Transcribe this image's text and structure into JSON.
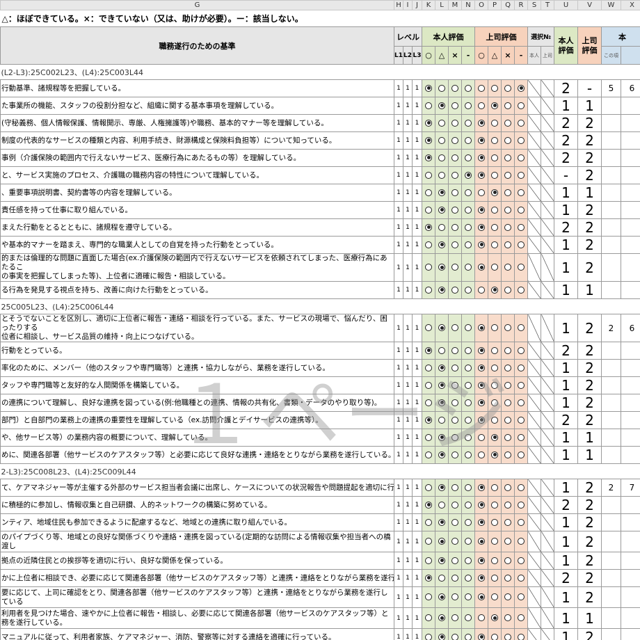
{
  "columns": [
    "G",
    "H",
    "I",
    "J",
    "K",
    "L",
    "M",
    "N",
    "O",
    "P",
    "Q",
    "R",
    "S",
    "T",
    "U",
    "V",
    "W",
    "X"
  ],
  "legend": "△：ほぼできている。×：できていない（又は、助けが必要）。ー：該当しない。",
  "header": {
    "criteria": "職務遂行のための基準",
    "level": "レベル",
    "level_sub": [
      "L1",
      "L2",
      "L3"
    ],
    "self_eval": "本人評価",
    "boss_eval": "上司評価",
    "eval_marks": [
      "○",
      "△",
      "×",
      "-"
    ],
    "select_no": "選択№",
    "select_sub": [
      "本人",
      "上司"
    ],
    "self_score": "本人評価",
    "boss_score": "上司評価",
    "extra": "本",
    "extra_sub": "この項"
  },
  "watermark": "１ページ",
  "rows": [
    {
      "type": "section",
      "text": "(L2-L3):25C002L23、(L4):25C003L44"
    },
    {
      "type": "item",
      "text": "行動基準、諸規程等を把握している。",
      "lv": [
        "1",
        "1",
        "1"
      ],
      "self": 0,
      "boss": 3,
      "ss": "2",
      "bs": "-",
      "w": "5",
      "x": "6"
    },
    {
      "type": "item",
      "text": "た事業所の機能、スタッフの役割分担など、組織に関する基本事項を理解している。",
      "lv": [
        "1",
        "1",
        "1"
      ],
      "self": 1,
      "boss": 1,
      "ss": "1",
      "bs": "1",
      "w": "",
      "x": ""
    },
    {
      "type": "item",
      "text": "(守秘義務、個人情報保護、情報開示、専厳、人権擁護等)や職務、基本的マナー等を理解している。",
      "lv": [
        "1",
        "1",
        "1"
      ],
      "self": 0,
      "boss": 0,
      "ss": "2",
      "bs": "2",
      "w": "",
      "x": ""
    },
    {
      "type": "item",
      "text": "制度の代表的なサービスの種類と内容、利用手続き、財源構成と保険料負担等）について知っている。",
      "lv": [
        "1",
        "1",
        "1"
      ],
      "self": 0,
      "boss": 0,
      "ss": "2",
      "bs": "2",
      "w": "",
      "x": ""
    },
    {
      "type": "item",
      "text": "事例（介護保険の範囲内で行えないサービス、医療行為にあたるもの等）を理解している。",
      "lv": [
        "1",
        "1",
        "1"
      ],
      "self": 0,
      "boss": 0,
      "ss": "2",
      "bs": "2",
      "w": "",
      "x": ""
    },
    {
      "type": "item",
      "text": "と、サービス実施のプロセス、介護職の職務内容の特性について理解している。",
      "lv": [
        "1",
        "1",
        "1"
      ],
      "self": 3,
      "boss": 0,
      "ss": "-",
      "bs": "2",
      "w": "",
      "x": ""
    },
    {
      "type": "item",
      "text": "、重要事項説明書、契約書等の内容を理解している。",
      "lv": [
        "1",
        "1",
        "1"
      ],
      "self": 1,
      "boss": 1,
      "ss": "1",
      "bs": "1",
      "w": "",
      "x": ""
    },
    {
      "type": "item",
      "text": "責任感を持って仕事に取り組んでいる。",
      "lv": [
        "1",
        "1",
        "1"
      ],
      "self": 1,
      "boss": 0,
      "ss": "1",
      "bs": "2",
      "w": "",
      "x": ""
    },
    {
      "type": "item",
      "text": "まえた行動をとるとともに、諸規程を遵守している。",
      "lv": [
        "1",
        "1",
        "1"
      ],
      "self": 0,
      "boss": 0,
      "ss": "2",
      "bs": "2",
      "w": "",
      "x": ""
    },
    {
      "type": "item",
      "text": "や基本的マナーを踏まえ、専門的な職業人としての自覚を持った行動をとっている。",
      "lv": [
        "1",
        "1",
        "1"
      ],
      "self": 1,
      "boss": 0,
      "ss": "1",
      "bs": "2",
      "w": "",
      "x": ""
    },
    {
      "type": "item2",
      "text": "的または倫理的な問題に直面した場合(ex.介護保険の範囲内で行えないサービスを依頼されてしまった、医療行為にあたるこ\nの事実を把握してしまった等)、上位者に適確に報告・相談している。",
      "lv": [
        "1",
        "1",
        "1"
      ],
      "self": 1,
      "boss": 0,
      "ss": "1",
      "bs": "2",
      "w": "",
      "x": ""
    },
    {
      "type": "item",
      "text": "る行為を発見する視点を持ち、改善に向けた行動をとっている。",
      "lv": [
        "1",
        "1",
        "1"
      ],
      "self": 1,
      "boss": 1,
      "ss": "1",
      "bs": "1",
      "w": "",
      "x": ""
    },
    {
      "type": "section",
      "text": "25C005L23、(L4):25C006L44"
    },
    {
      "type": "item2",
      "text": "とそうでないことを区別し、適切に上位者に報告・連絡・相談を行っている。また、サービスの現場で、悩んだり、困ったりする\n位者に相談し、サービス品質の維持・向上につなげている。",
      "lv": [
        "1",
        "1",
        "1"
      ],
      "self": 1,
      "boss": 0,
      "ss": "1",
      "bs": "2",
      "w": "2",
      "x": "6"
    },
    {
      "type": "item",
      "text": "行動をとっている。",
      "lv": [
        "1",
        "1",
        "1"
      ],
      "self": 0,
      "boss": 0,
      "ss": "2",
      "bs": "2",
      "w": "",
      "x": ""
    },
    {
      "type": "item",
      "text": "率化のために、メンバー（他のスタッフや専門職等）と連携・協力しながら、業務を遂行している。",
      "lv": [
        "1",
        "1",
        "1"
      ],
      "self": 1,
      "boss": 0,
      "ss": "1",
      "bs": "2",
      "w": "",
      "x": ""
    },
    {
      "type": "item",
      "text": "タッフや専門職等と友好的な人間関係を構築している。",
      "lv": [
        "1",
        "1",
        "1"
      ],
      "self": 1,
      "boss": 0,
      "ss": "1",
      "bs": "2",
      "w": "",
      "x": ""
    },
    {
      "type": "item",
      "text": "の連携について理解し、良好な連携を図っている(例:他職種との連携、情報の共有化、書類・データのやり取り等)。",
      "lv": [
        "1",
        "1",
        "1"
      ],
      "self": 1,
      "boss": 0,
      "ss": "1",
      "bs": "2",
      "w": "",
      "x": ""
    },
    {
      "type": "item",
      "text": "部門）と自部門の業務上の連携の重要性を理解している（ex.訪問介護とデイサービスの連携等）。",
      "lv": [
        "1",
        "1",
        "1"
      ],
      "self": 0,
      "boss": 0,
      "ss": "2",
      "bs": "2",
      "w": "",
      "x": ""
    },
    {
      "type": "item",
      "text": "や、他サービス等）の業務内容の概要について、理解している。",
      "lv": [
        "1",
        "1",
        "1"
      ],
      "self": 1,
      "boss": 1,
      "ss": "1",
      "bs": "1",
      "w": "",
      "x": ""
    },
    {
      "type": "item",
      "text": "めに、関連各部署（他サービスのケアスタッフ等）と必要に応じて良好な連携・連絡をとりながら業務を遂行している。",
      "lv": [
        "1",
        "1",
        "1"
      ],
      "self": 1,
      "boss": 1,
      "ss": "1",
      "bs": "1",
      "w": "",
      "x": ""
    },
    {
      "type": "section",
      "text": "2-L3):25C008L23、(L4):25C009L44"
    },
    {
      "type": "item",
      "text": "て、ケアマネジャー等が主催する外部のサービス担当者会議に出席し、ケースについての状況報告や問題提起を適切に行っ",
      "lv": [
        "1",
        "1",
        "1"
      ],
      "self": 1,
      "boss": 0,
      "ss": "1",
      "bs": "2",
      "w": "2",
      "x": "7"
    },
    {
      "type": "item",
      "text": "に積極的に参加し、情報収集と自己研鑽、人的ネットワークの構築に努めている。",
      "lv": [
        "1",
        "1",
        "1"
      ],
      "self": 0,
      "boss": 0,
      "ss": "2",
      "bs": "2",
      "w": "",
      "x": ""
    },
    {
      "type": "item",
      "text": "ンティア、地域住民も参加できるように配慮するなど、地域との連携に取り組んでいる。",
      "lv": [
        "1",
        "1",
        "1"
      ],
      "self": 1,
      "boss": 0,
      "ss": "1",
      "bs": "2",
      "w": "",
      "x": ""
    },
    {
      "type": "item2",
      "text": "のパイプづくり等、地域との良好な関係づくりや連絡・連携を図っている(定期的な訪問による情報収集や担当者への橋渡し\n ",
      "lv": [
        "1",
        "1",
        "1"
      ],
      "self": 1,
      "boss": 0,
      "ss": "1",
      "bs": "2",
      "w": "",
      "x": ""
    },
    {
      "type": "item",
      "text": "拠点の近隣住民との挨拶等を適切に行い、良好な関係を保っている。",
      "lv": [
        "1",
        "1",
        "1"
      ],
      "self": 1,
      "boss": 0,
      "ss": "1",
      "bs": "2",
      "w": "",
      "x": ""
    },
    {
      "type": "item",
      "text": "かに上位者に相談でき、必要に応じて関連各部署（他サービスのケアスタッフ等）と連携・連絡をとりながら業務を遂行してい",
      "lv": [
        "1",
        "1",
        "1"
      ],
      "self": 0,
      "boss": 0,
      "ss": "2",
      "bs": "2",
      "w": "",
      "x": ""
    },
    {
      "type": "item2",
      "text": "要に応じて、上司に確認をとり、関連各部署（他サービスのケアスタッフ等）と連携・連絡をとりながら業務を遂行している\n ",
      "lv": [
        "1",
        "1",
        "1"
      ],
      "self": 1,
      "boss": 0,
      "ss": "1",
      "bs": "2",
      "w": "",
      "x": ""
    },
    {
      "type": "item2",
      "text": "利用者を見つけた場合、速やかに上位者に報告・相談し、必要に応じて関連各部署（他サービスのケアスタッフ等）と\n務を遂行している。",
      "lv": [
        "1",
        "1",
        "1"
      ],
      "self": 1,
      "boss": 1,
      "ss": "1",
      "bs": "1",
      "w": "",
      "x": ""
    },
    {
      "type": "item",
      "text": "マニュアルに従って、利用者家族、ケアマネジャー、消防、警察等に対する連絡を適確に行っている。",
      "lv": [
        "1",
        "1",
        "1"
      ],
      "self": 1,
      "boss": 0,
      "ss": "1",
      "bs": "2",
      "w": "",
      "x": ""
    }
  ]
}
